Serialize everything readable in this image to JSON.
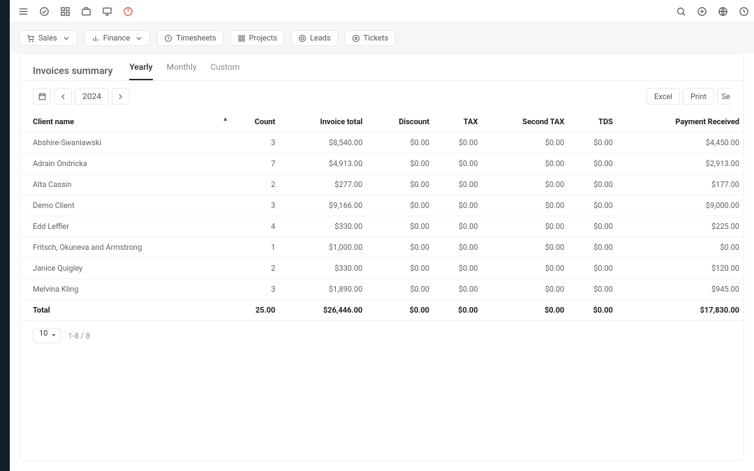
{
  "nav": {
    "sales": "Sales",
    "finance": "Finance",
    "timesheets": "Timesheets",
    "projects": "Projects",
    "leads": "Leads",
    "tickets": "Tickets"
  },
  "page_title": "Invoices summary",
  "tabs": {
    "yearly": "Yearly",
    "monthly": "Monthly",
    "custom": "Custom"
  },
  "year": "2024",
  "buttons": {
    "excel": "Excel",
    "print": "Print",
    "search_cut": "Se"
  },
  "columns": {
    "client": "Client name",
    "count": "Count",
    "invoice_total": "Invoice total",
    "discount": "Discount",
    "tax": "TAX",
    "second_tax": "Second TAX",
    "tds": "TDS",
    "payment_received": "Payment Received"
  },
  "rows": [
    {
      "client": "Abshire-Swaniawski",
      "count": "3",
      "invoice_total": "$8,540.00",
      "discount": "$0.00",
      "tax": "$0.00",
      "second_tax": "$0.00",
      "tds": "$0.00",
      "payment_received": "$4,450.00"
    },
    {
      "client": "Adrain Ondricka",
      "count": "7",
      "invoice_total": "$4,913.00",
      "discount": "$0.00",
      "tax": "$0.00",
      "second_tax": "$0.00",
      "tds": "$0.00",
      "payment_received": "$2,913.00"
    },
    {
      "client": "Alta Cassin",
      "count": "2",
      "invoice_total": "$277.00",
      "discount": "$0.00",
      "tax": "$0.00",
      "second_tax": "$0.00",
      "tds": "$0.00",
      "payment_received": "$177.00"
    },
    {
      "client": "Demo Client",
      "count": "3",
      "invoice_total": "$9,166.00",
      "discount": "$0.00",
      "tax": "$0.00",
      "second_tax": "$0.00",
      "tds": "$0.00",
      "payment_received": "$9,000.00"
    },
    {
      "client": "Edd Leffler",
      "count": "4",
      "invoice_total": "$330.00",
      "discount": "$0.00",
      "tax": "$0.00",
      "second_tax": "$0.00",
      "tds": "$0.00",
      "payment_received": "$225.00"
    },
    {
      "client": "Fritsch, Okuneva and Armstrong",
      "count": "1",
      "invoice_total": "$1,000.00",
      "discount": "$0.00",
      "tax": "$0.00",
      "second_tax": "$0.00",
      "tds": "$0.00",
      "payment_received": "$0.00"
    },
    {
      "client": "Janice Quigley",
      "count": "2",
      "invoice_total": "$330.00",
      "discount": "$0.00",
      "tax": "$0.00",
      "second_tax": "$0.00",
      "tds": "$0.00",
      "payment_received": "$120.00"
    },
    {
      "client": "Melvina Kling",
      "count": "3",
      "invoice_total": "$1,890.00",
      "discount": "$0.00",
      "tax": "$0.00",
      "second_tax": "$0.00",
      "tds": "$0.00",
      "payment_received": "$945.00"
    }
  ],
  "totals": {
    "label": "Total",
    "count": "25.00",
    "invoice_total": "$26,446.00",
    "discount": "$0.00",
    "tax": "$0.00",
    "second_tax": "$0.00",
    "tds": "$0.00",
    "payment_received": "$17,830.00"
  },
  "pager": {
    "page_size": "10",
    "range": "1-8 / 8"
  }
}
